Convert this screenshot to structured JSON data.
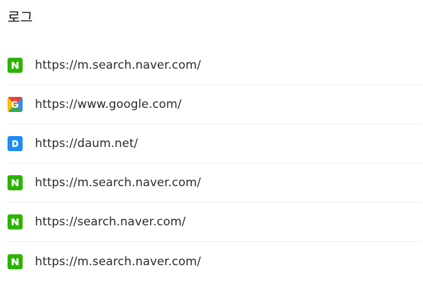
{
  "header": {
    "title": "로그"
  },
  "log": {
    "items": [
      {
        "site": "naver",
        "icon": "naver-icon",
        "url": "https://m.search.naver.com/"
      },
      {
        "site": "google",
        "icon": "google-icon",
        "url": "https://www.google.com/"
      },
      {
        "site": "daum",
        "icon": "daum-icon",
        "url": "https://daum.net/"
      },
      {
        "site": "naver",
        "icon": "naver-icon",
        "url": "https://m.search.naver.com/"
      },
      {
        "site": "naver",
        "icon": "naver-icon",
        "url": "https://search.naver.com/"
      },
      {
        "site": "naver",
        "icon": "naver-icon",
        "url": "https://m.search.naver.com/"
      }
    ]
  },
  "colors": {
    "naver": "#2db400",
    "daum": "#1f8cf5",
    "google_red": "#ea4335",
    "google_yellow": "#fbbc05",
    "google_green": "#34a853",
    "google_blue": "#4285f4",
    "divider": "#eeeeee",
    "text": "#2b2b2b"
  }
}
